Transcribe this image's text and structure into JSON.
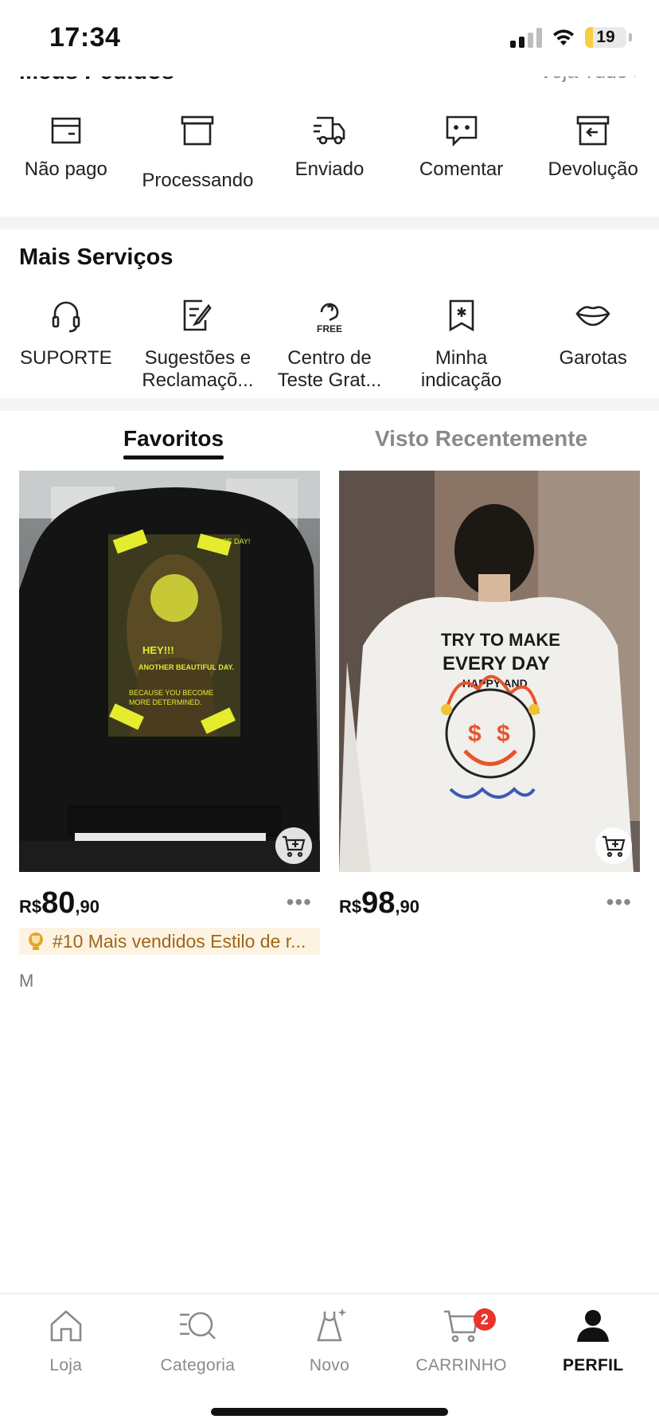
{
  "status_bar": {
    "time": "17:34",
    "battery": "19",
    "battery_level": 0.19
  },
  "orders": {
    "title": "Meus Pedidos",
    "view_all": "Veja Tudo",
    "items": [
      {
        "label": "Não pago",
        "icon": "wallet-icon"
      },
      {
        "label": "Processando",
        "icon": "box-icon"
      },
      {
        "label": "Enviado",
        "icon": "truck-icon"
      },
      {
        "label": "Comentar",
        "icon": "comment-icon"
      },
      {
        "label": "Devolução",
        "icon": "return-box-icon"
      }
    ]
  },
  "services": {
    "title": "Mais Serviços",
    "items": [
      {
        "label": "SUPORTE",
        "icon": "headset-icon"
      },
      {
        "label": "Sugestões e Reclamaçõ...",
        "icon": "edit-document-icon"
      },
      {
        "label": "Centro de Teste Grat...",
        "icon": "free-trial-icon",
        "icon_text": "FREE"
      },
      {
        "label": "Minha indicação",
        "icon": "bookmark-star-icon"
      },
      {
        "label": "Garotas",
        "icon": "lips-icon"
      }
    ]
  },
  "tabs": {
    "favorites": "Favoritos",
    "recent": "Visto Recentemente"
  },
  "products": [
    {
      "image_desc": "black sweatshirt with neon art print",
      "image_text": {
        "line1": "NICE DAY!",
        "line2": "HEY!!!",
        "line3": "ANOTHER BEAUTIFUL DAY.",
        "line4": "BECAUSE YOU BECOME",
        "line5": "MORE DETERMINED."
      },
      "currency": "R$",
      "price_int": "80",
      "price_dec": ",90",
      "badge": "#10 Mais vendidos Estilo de r...",
      "size": "M"
    },
    {
      "image_desc": "white sweatshirt with graffiti smiley print",
      "image_text": {
        "line1": "TRY TO MAKE",
        "line2": "EVERY DAY",
        "line3": "HAPPY AND"
      },
      "currency": "R$",
      "price_int": "98",
      "price_dec": ",90"
    }
  ],
  "bottom_nav": {
    "items": [
      {
        "label": "Loja",
        "icon": "home-icon"
      },
      {
        "label": "Categoria",
        "icon": "category-search-icon"
      },
      {
        "label": "Novo",
        "icon": "new-dress-icon"
      },
      {
        "label": "CARRINHO",
        "icon": "cart-icon",
        "badge": "2"
      },
      {
        "label": "PERFIL",
        "icon": "profile-icon",
        "active": true
      }
    ]
  },
  "colors": {
    "accent": "#111111",
    "badge_red": "#e9342b",
    "badge_bg": "#fdf3e2",
    "badge_text": "#a0661a",
    "battery": "#f7cf3f"
  }
}
